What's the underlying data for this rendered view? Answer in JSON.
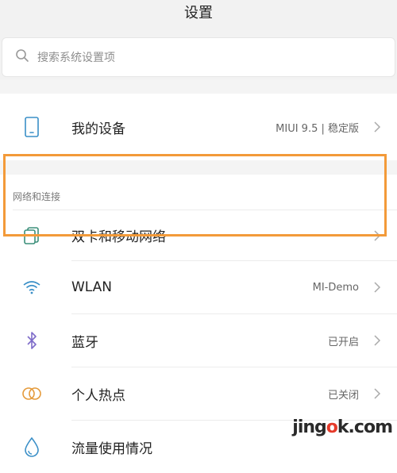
{
  "header": {
    "title": "设置"
  },
  "search": {
    "placeholder": "搜索系统设置项"
  },
  "device": {
    "label": "我的设备",
    "value": "MIUI 9.5 | 稳定版"
  },
  "network_section": {
    "title": "网络和连接"
  },
  "items": [
    {
      "label": "双卡和移动网络",
      "value": ""
    },
    {
      "label": "WLAN",
      "value": "MI-Demo"
    },
    {
      "label": "蓝牙",
      "value": "已开启"
    },
    {
      "label": "个人热点",
      "value": "已关闭"
    },
    {
      "label": "流量使用情况",
      "value": ""
    }
  ],
  "watermark": {
    "pre": "jing",
    "o": "o",
    "post": "k.com"
  },
  "colors": {
    "highlight": "#f39a39",
    "icon_primary": "#3a8fc7",
    "icon_green": "#3b8f7a",
    "icon_purple": "#7e6cc9",
    "icon_orange": "#e59a3a"
  }
}
